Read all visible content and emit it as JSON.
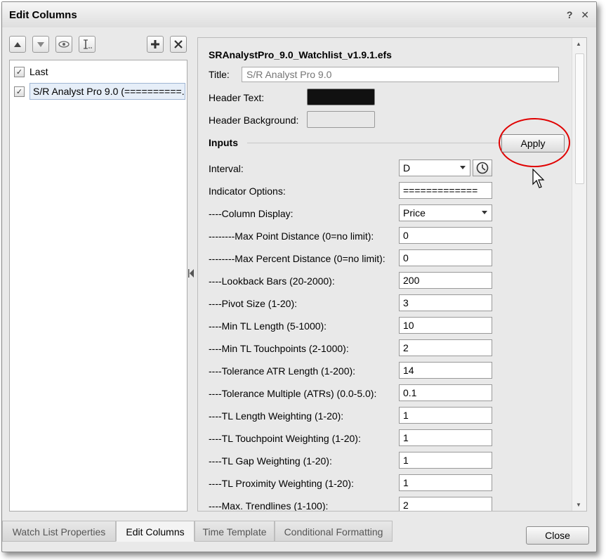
{
  "window": {
    "title": "Edit Columns",
    "help_glyph": "?",
    "close_glyph": "✕"
  },
  "left_toolbar": {
    "icons": [
      "arrow-up-icon",
      "arrow-down-icon",
      "eye-icon",
      "rename-icon",
      "add-icon",
      "delete-icon"
    ]
  },
  "columns_list": [
    {
      "label": "Last",
      "checked": true
    },
    {
      "label": "S/R Analyst Pro 9.0 (==========...",
      "checked": true,
      "selected": true
    }
  ],
  "properties": {
    "file_title": "SRAnalystPro_9.0_Watchlist_v1.9.1.efs",
    "title_label": "Title:",
    "title_placeholder": "S/R Analyst Pro 9.0",
    "header_text_label": "Header Text:",
    "header_text_color": "#111111",
    "header_bg_label": "Header Background:",
    "header_bg_color": "#e8e8e8",
    "inputs_label": "Inputs",
    "apply_label": "Apply"
  },
  "inputs": [
    {
      "label": "Interval:",
      "value": "D",
      "kind": "interval"
    },
    {
      "label": "Indicator Options:",
      "value": "=============",
      "kind": "text"
    },
    {
      "label": "----Column Display:",
      "value": "Price",
      "kind": "combo"
    },
    {
      "label": "--------Max Point Distance (0=no limit):",
      "value": "0",
      "kind": "text"
    },
    {
      "label": "--------Max Percent Distance (0=no limit):",
      "value": "0",
      "kind": "text"
    },
    {
      "label": "----Lookback Bars (20-2000):",
      "value": "200",
      "kind": "text"
    },
    {
      "label": "----Pivot Size (1-20):",
      "value": "3",
      "kind": "text"
    },
    {
      "label": "----Min TL Length (5-1000):",
      "value": "10",
      "kind": "text"
    },
    {
      "label": "----Min TL Touchpoints (2-1000):",
      "value": "2",
      "kind": "text"
    },
    {
      "label": "----Tolerance ATR Length (1-200):",
      "value": "14",
      "kind": "text"
    },
    {
      "label": "----Tolerance Multiple (ATRs) (0.0-5.0):",
      "value": "0.1",
      "kind": "text"
    },
    {
      "label": "----TL Length Weighting (1-20):",
      "value": "1",
      "kind": "text"
    },
    {
      "label": "----TL Touchpoint Weighting (1-20):",
      "value": "1",
      "kind": "text"
    },
    {
      "label": "----TL Gap Weighting (1-20):",
      "value": "1",
      "kind": "text"
    },
    {
      "label": "----TL Proximity Weighting (1-20):",
      "value": "1",
      "kind": "text"
    },
    {
      "label": "----Max. Trendlines (1-100):",
      "value": "2",
      "kind": "text"
    }
  ],
  "tabs": [
    {
      "label": "Watch List Properties",
      "active": false
    },
    {
      "label": "Edit Columns",
      "active": true
    },
    {
      "label": "Time Template",
      "active": false
    },
    {
      "label": "Conditional Formatting",
      "active": false
    }
  ],
  "close_label": "Close",
  "colors": {
    "highlight_ellipse": "#e00000",
    "selection": "#e6eef8"
  }
}
